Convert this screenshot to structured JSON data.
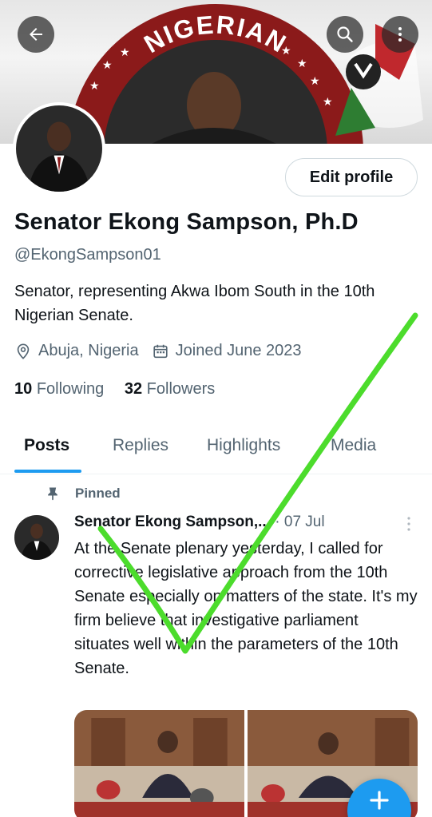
{
  "banner": {
    "arc_text": "NIGERIAN",
    "back_icon": "arrow-left-icon",
    "search_icon": "search-icon",
    "more_icon": "more-vertical-icon"
  },
  "profile": {
    "edit_button_label": "Edit profile",
    "name": "Senator Ekong Sampson, Ph.D",
    "handle": "@EkongSampson01",
    "bio": "Senator, representing Akwa Ibom South in the 10th Nigerian Senate.",
    "location": "Abuja, Nigeria",
    "joined": "Joined June 2023",
    "following_count": "10",
    "following_label": "Following",
    "followers_count": "32",
    "followers_label": "Followers"
  },
  "tabs": [
    {
      "label": "Posts",
      "active": true
    },
    {
      "label": "Replies",
      "active": false
    },
    {
      "label": "Highlights",
      "active": false
    },
    {
      "label": "Media",
      "active": false
    }
  ],
  "post": {
    "pinned_label": "Pinned",
    "author": "Senator Ekong Sampson,...",
    "separator": " · ",
    "date": "07 Jul",
    "text": "At the Senate plenary yesterday, I called for corrective legislative approach from the 10th Senate especially on matters of the state. It's my firm believe that investigative parliament situates well within the parameters of the 10th Senate."
  },
  "fab": {
    "icon": "plus-icon"
  },
  "colors": {
    "accent": "#1d9bf0",
    "text_primary": "#0f1419",
    "text_secondary": "#536471",
    "check_overlay": "#4cdc2c",
    "banner_maroon": "#8b1a1a"
  }
}
